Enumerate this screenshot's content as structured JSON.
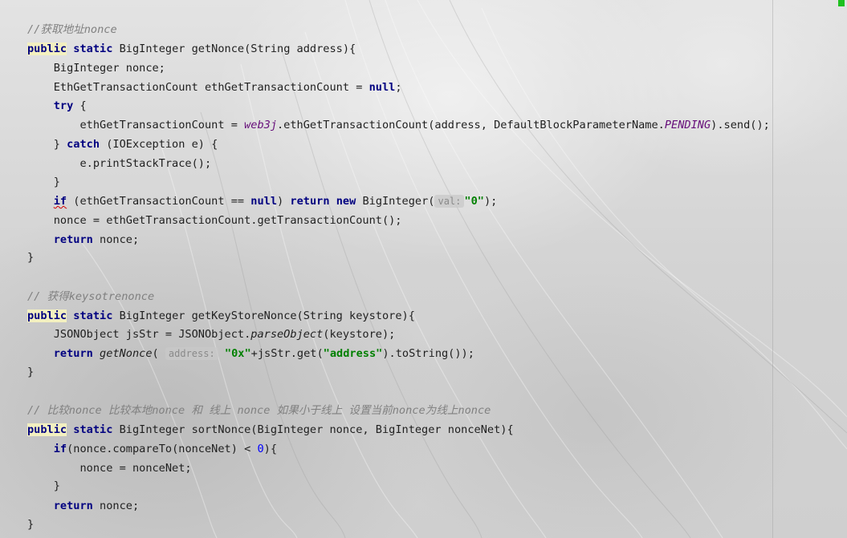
{
  "comments": {
    "c1": {
      "prefix": "//获取地址",
      "suffix": "nonce"
    },
    "c2": {
      "prefix": "// 获得",
      "suffix": "keysotrenonce"
    },
    "c3": {
      "p1": "// 比较",
      "i1": "nonce",
      "p2": " 比较本地",
      "i2": "nonce",
      "p3": " 和 线上 ",
      "i3": "nonce",
      "p4": " 如果小于线上 设置当前",
      "i4": "nonce",
      "p5": "为线上",
      "i5": "nonce"
    }
  },
  "kw": {
    "public": "public",
    "static": "static",
    "try": "try",
    "catch": "catch",
    "null": "null",
    "if": "if",
    "return": "return",
    "new": "new"
  },
  "m1": {
    "sig": " BigInteger getNonce(String address){",
    "l2": "    BigInteger nonce;",
    "l3_a": "    EthGetTransactionCount ethGetTransactionCount = ",
    "l3_b": ";",
    "l4_a": "    ",
    "l4_b": " {",
    "l5_a": "        ethGetTransactionCount = ",
    "l5_web3j": "web3j",
    "l5_b": ".ethGetTransactionCount(address, DefaultBlockParameterName.",
    "l5_pending": "PENDING",
    "l5_c": ").send();",
    "l6_a": "    } ",
    "l6_b": " (IOException e) {",
    "l7": "        e.printStackTrace();",
    "l8": "    }",
    "l9_a": "    ",
    "l9_b": " (ethGetTransactionCount == ",
    "l9_c": ") ",
    "l9_d": " ",
    "l9_e": " BigInteger(",
    "l9_hint": "val:",
    "l9_str": "\"0\"",
    "l9_f": ");",
    "l10": "    nonce = ethGetTransactionCount.getTransactionCount();",
    "l11_a": "    ",
    "l11_b": " nonce;",
    "close": "}"
  },
  "m2": {
    "sig": " BigInteger getKeyStoreNonce(String keystore){",
    "l2_a": "    JSONObject jsStr = JSONObject.",
    "l2_parse": "parseObject",
    "l2_b": "(keystore);",
    "l3_a": "    ",
    "l3_call": "getNonce",
    "l3_b": "( ",
    "l3_hint": "address:",
    "l3_str1": "\"0x\"",
    "l3_c": "+jsStr.get(",
    "l3_str2": "\"address\"",
    "l3_d": ").toString());",
    "close": "}"
  },
  "m3": {
    "sig": " BigInteger sortNonce(BigInteger nonce, BigInteger nonceNet){",
    "l2_a": "    ",
    "l2_b": "(nonce.compareTo(nonceNet) < ",
    "l2_num": "0",
    "l2_c": "){",
    "l3": "        nonce = nonceNet;",
    "l4": "    }",
    "l5_a": "    ",
    "l5_b": " nonce;",
    "close": "}"
  }
}
